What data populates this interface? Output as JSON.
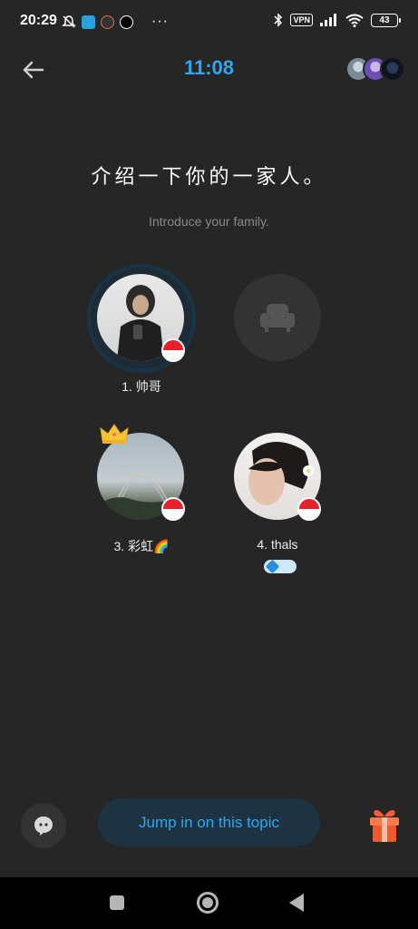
{
  "status_bar": {
    "time": "20:29",
    "vpn_label": "VPN",
    "battery": "43",
    "more": "···",
    "icons": [
      "mute-icon",
      "telegram-icon",
      "app-icon",
      "threads-icon",
      "bluetooth-icon",
      "signal-icon",
      "wifi-icon"
    ]
  },
  "header": {
    "timer": "11:08",
    "back_icon": "arrow-left-icon",
    "participants_icon": "participants-avatars"
  },
  "topic": {
    "title": "介绍一下你的一家人。",
    "subtitle": "Introduce your family."
  },
  "seats": [
    {
      "label": "1. 帅哥",
      "speaking": true,
      "flag": "indonesia"
    },
    {
      "label": "",
      "empty": true,
      "icon": "armchair-icon"
    },
    {
      "label": "3. 彩虹🌈",
      "crown": true,
      "flag": "indonesia"
    },
    {
      "label": "4. thals",
      "flag": "indonesia",
      "badge": "gem-badge"
    }
  ],
  "actions": {
    "jump_in": "Jump in on this topic",
    "chat_icon": "chat-bubble-icon",
    "gift_icon": "gift-icon"
  },
  "colors": {
    "accent": "#2ea7f0",
    "background": "#262626",
    "button_bg": "#1e3342"
  }
}
